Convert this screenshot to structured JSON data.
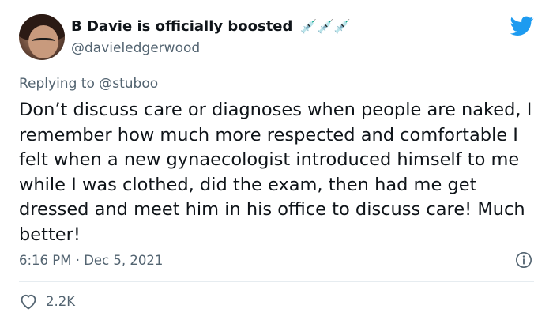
{
  "tweet": {
    "display_name": "B Davie is officially boosted",
    "name_emoji": "💉💉💉",
    "handle": "@davieledgerwood",
    "replying_to": "Replying to @stuboo",
    "text": "Don’t discuss care or diagnoses when people are naked, I remember how much more respected and comfortable I felt when a new gynaecologist introduced himself to me while I was clothed, did the exam, then had me get dressed and meet him in his office to discuss care! Much better!",
    "timestamp": "6:16 PM · Dec 5, 2021",
    "likes": "2.2K"
  },
  "colors": {
    "twitter_blue": "#1d9bf0",
    "secondary_text": "#536471",
    "divider": "#e6ecf0"
  },
  "icons": {
    "brand": "twitter-bird-icon",
    "info": "info-icon",
    "like": "heart-icon"
  }
}
